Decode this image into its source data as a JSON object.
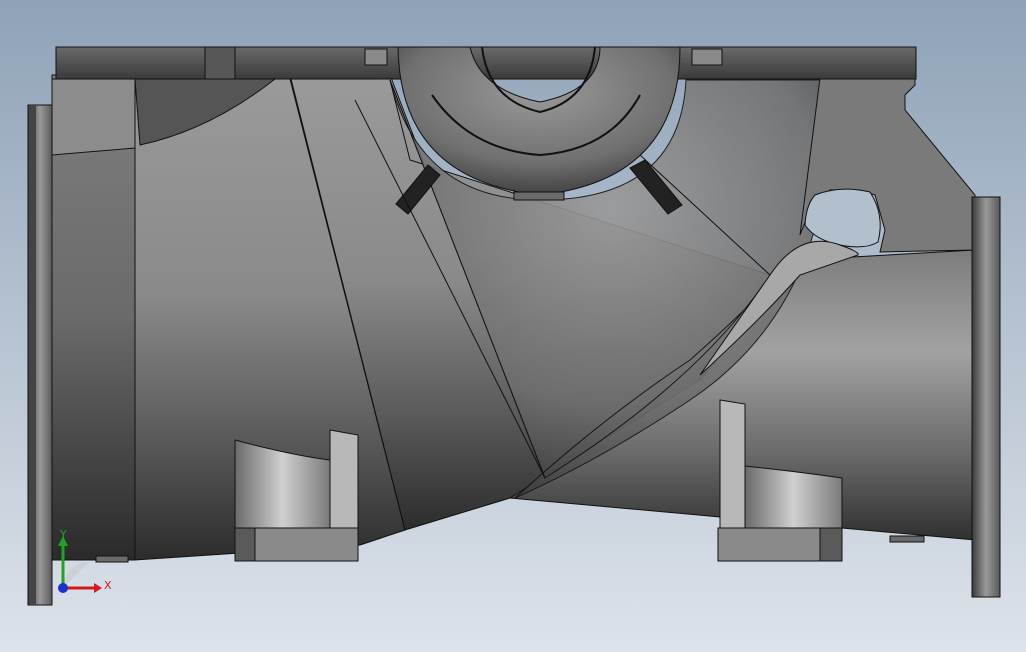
{
  "viewport": {
    "background_top": "#8fa2b8",
    "background_bottom": "#dde3ea"
  },
  "model": {
    "name": "pump casing",
    "body_color": "#808080",
    "edge_color": "#111111"
  },
  "triad": {
    "x_label": "X",
    "y_label": "Y",
    "x_color": "#d21a1a",
    "y_color": "#1fa12a",
    "z_color": "#1a2fd2"
  }
}
